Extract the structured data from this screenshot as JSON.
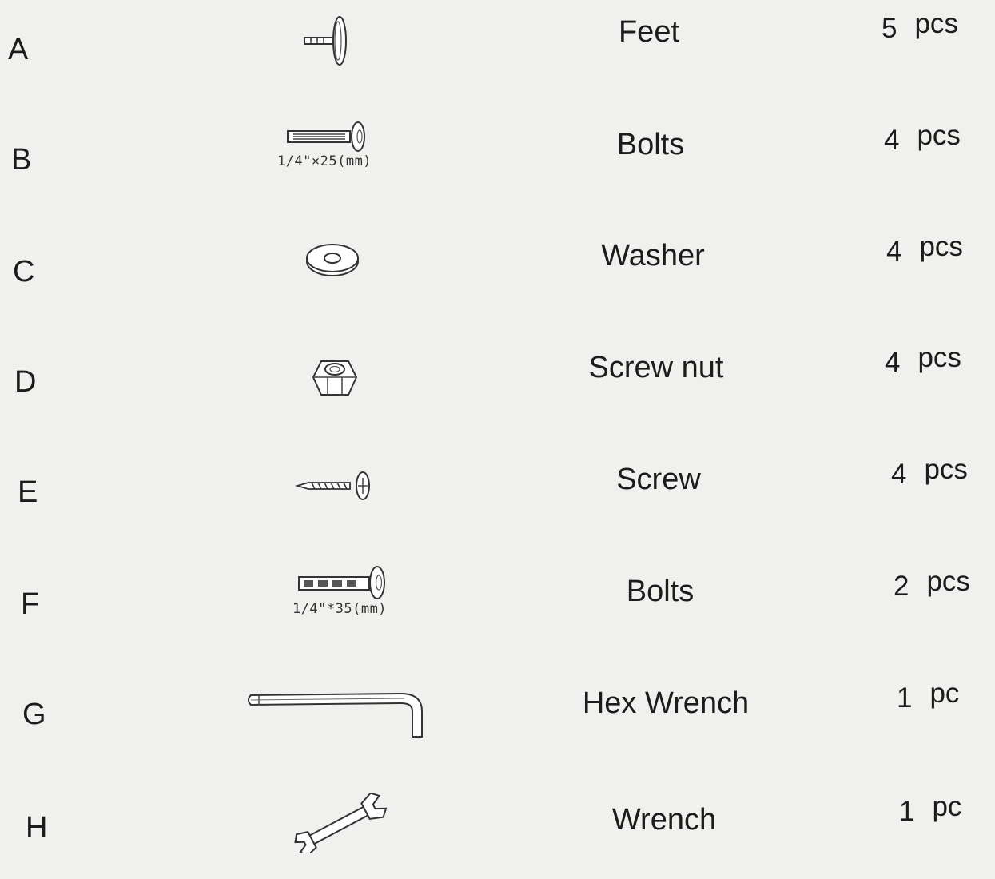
{
  "parts": [
    {
      "letter": "A",
      "icon": "feet-icon",
      "name": "Feet",
      "dimension": "",
      "quantity": "5",
      "unit": "pcs"
    },
    {
      "letter": "B",
      "icon": "bolt-icon",
      "name": "Bolts",
      "dimension": "1/4\"×25(mm)",
      "quantity": "4",
      "unit": "pcs"
    },
    {
      "letter": "C",
      "icon": "washer-icon",
      "name": "Washer",
      "dimension": "",
      "quantity": "4",
      "unit": "pcs"
    },
    {
      "letter": "D",
      "icon": "hex-nut-icon",
      "name": "Screw nut",
      "dimension": "",
      "quantity": "4",
      "unit": "pcs"
    },
    {
      "letter": "E",
      "icon": "screw-icon",
      "name": "Screw",
      "dimension": "",
      "quantity": "4",
      "unit": "pcs"
    },
    {
      "letter": "F",
      "icon": "bolt-icon",
      "name": "Bolts",
      "dimension": "1/4\"*35(mm)",
      "quantity": "2",
      "unit": "pcs"
    },
    {
      "letter": "G",
      "icon": "hex-wrench-icon",
      "name": "Hex Wrench",
      "dimension": "",
      "quantity": "1",
      "unit": "pc"
    },
    {
      "letter": "H",
      "icon": "wrench-icon",
      "name": "Wrench",
      "dimension": "",
      "quantity": "1",
      "unit": "pc"
    }
  ]
}
